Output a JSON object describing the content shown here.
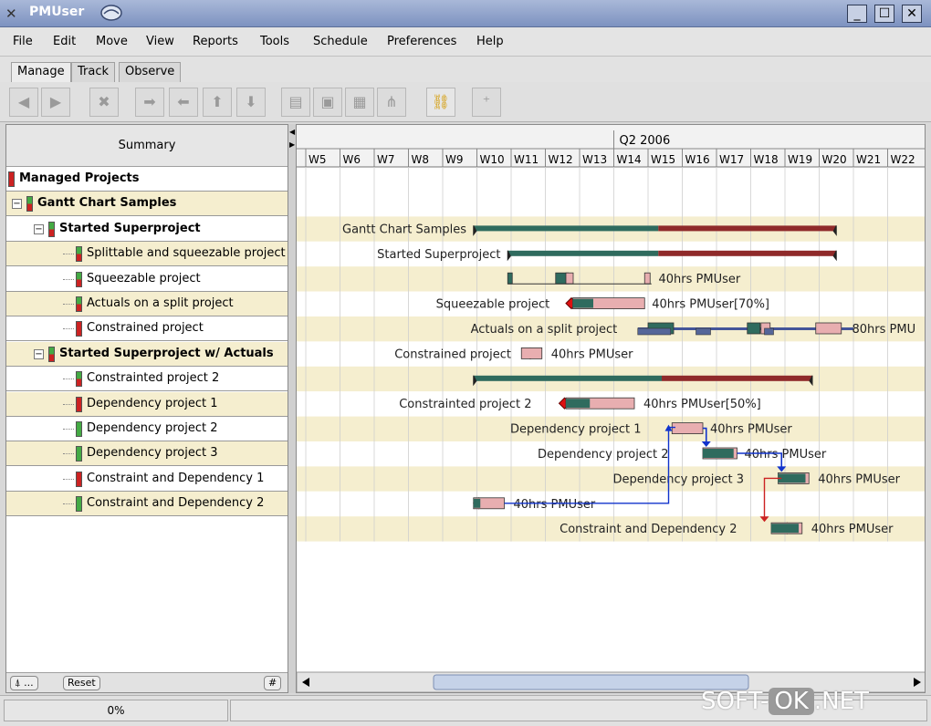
{
  "window": {
    "title": "PMUser",
    "minimize": "_",
    "maximize": "☐",
    "close": "✕"
  },
  "menu": [
    "File",
    "Edit",
    "Move",
    "View",
    "Reports",
    "Tools",
    "Schedule",
    "Preferences",
    "Help"
  ],
  "tabs": [
    {
      "label": "Manage",
      "active": true
    },
    {
      "label": "Track",
      "active": false
    },
    {
      "label": "Observe",
      "active": false
    }
  ],
  "toolbar": {
    "buttons": [
      {
        "name": "indent-left-icon",
        "glyph": "◀"
      },
      {
        "name": "indent-right-icon",
        "glyph": "▶"
      },
      {
        "name": "delete-icon",
        "glyph": "✖"
      },
      {
        "name": "arrow-right-icon",
        "glyph": "➡"
      },
      {
        "name": "arrow-left-icon",
        "glyph": "⬅"
      },
      {
        "name": "arrow-up-icon",
        "glyph": "⬆"
      },
      {
        "name": "arrow-down-icon",
        "glyph": "⬇"
      },
      {
        "name": "cut-icon",
        "glyph": "▤"
      },
      {
        "name": "copy-icon",
        "glyph": "▣"
      },
      {
        "name": "paste-icon",
        "glyph": "▦"
      },
      {
        "name": "tree-icon",
        "glyph": "⋔"
      },
      {
        "name": "link-icon",
        "glyph": "⛓"
      },
      {
        "name": "add-link-icon",
        "glyph": "⁺"
      }
    ]
  },
  "summary_header": "Summary",
  "tree": [
    {
      "label": "Managed Projects",
      "bold": true,
      "flag": "red",
      "level": 0,
      "expander": ""
    },
    {
      "label": "Gantt Chart Samples",
      "bold": true,
      "flag": "mixed",
      "level": 1,
      "expander": "−"
    },
    {
      "label": "Started Superproject",
      "bold": true,
      "flag": "mixed",
      "level": 2,
      "expander": "−"
    },
    {
      "label": "Splittable and squeezable project",
      "bold": false,
      "flag": "mixed",
      "level": 3,
      "expander": ""
    },
    {
      "label": "Squeezable project",
      "bold": false,
      "flag": "mixed",
      "level": 3,
      "expander": ""
    },
    {
      "label": "Actuals on a split project",
      "bold": false,
      "flag": "mixed",
      "level": 3,
      "expander": ""
    },
    {
      "label": "Constrained project",
      "bold": false,
      "flag": "red",
      "level": 3,
      "expander": ""
    },
    {
      "label": "Started Superproject w/ Actuals",
      "bold": true,
      "flag": "mixed",
      "level": 2,
      "expander": "−"
    },
    {
      "label": "Constrainted project 2",
      "bold": false,
      "flag": "mixed",
      "level": 3,
      "expander": ""
    },
    {
      "label": "Dependency project 1",
      "bold": false,
      "flag": "red",
      "level": 3,
      "expander": ""
    },
    {
      "label": "Dependency project 2",
      "bold": false,
      "flag": "green",
      "level": 3,
      "expander": ""
    },
    {
      "label": "Dependency project 3",
      "bold": false,
      "flag": "green",
      "level": 3,
      "expander": ""
    },
    {
      "label": "Constraint and Dependency 1",
      "bold": false,
      "flag": "red",
      "level": 3,
      "expander": ""
    },
    {
      "label": "Constraint and Dependency 2",
      "bold": false,
      "flag": "green",
      "level": 3,
      "expander": ""
    }
  ],
  "left_footer": {
    "find_label": "...",
    "reset_label": "Reset",
    "hash_label": "#"
  },
  "chart": {
    "quarter_label": "Q2 2006",
    "weeks": [
      "W5",
      "W6",
      "W7",
      "W8",
      "W9",
      "W10",
      "W11",
      "W12",
      "W13",
      "W14",
      "W15",
      "W16",
      "W17",
      "W18",
      "W19",
      "W20",
      "W21",
      "W22"
    ],
    "rows": [
      {
        "name": "",
        "note": ""
      },
      {
        "name": "Gantt Chart Samples",
        "note": ""
      },
      {
        "name": "Started Superproject",
        "note": ""
      },
      {
        "name": "",
        "note": "40hrs PMUser"
      },
      {
        "name": "Squeezable project",
        "note": "40hrs PMUser[70%]"
      },
      {
        "name": "Actuals on a split project",
        "note": "80hrs PMU"
      },
      {
        "name": "Constrained project",
        "note": "40hrs PMUser"
      },
      {
        "name": "",
        "note": ""
      },
      {
        "name": "Constrainted project 2",
        "note": "40hrs PMUser[50%]"
      },
      {
        "name": "Dependency project 1",
        "note": "40hrs PMUser"
      },
      {
        "name": "Dependency project 2",
        "note": "40hrs PMUser"
      },
      {
        "name": "Dependency project 3",
        "note": "40hrs PMUser"
      },
      {
        "name": "",
        "note": "40hrs PMUser"
      },
      {
        "name": "Constraint and Dependency 2",
        "note": "40hrs PMUser"
      }
    ]
  },
  "status": {
    "progress": "0%"
  },
  "watermark": {
    "left": "SOFT-",
    "ok": "OK",
    "right": ".NET"
  },
  "colors": {
    "row_alt": "#f5eecf",
    "bar_done": "#2f6b5e",
    "bar_todo": "#8f2a2a",
    "bar_light": "#e8aeb0",
    "link_blue": "#1133cc",
    "link_red": "#cc2222"
  }
}
